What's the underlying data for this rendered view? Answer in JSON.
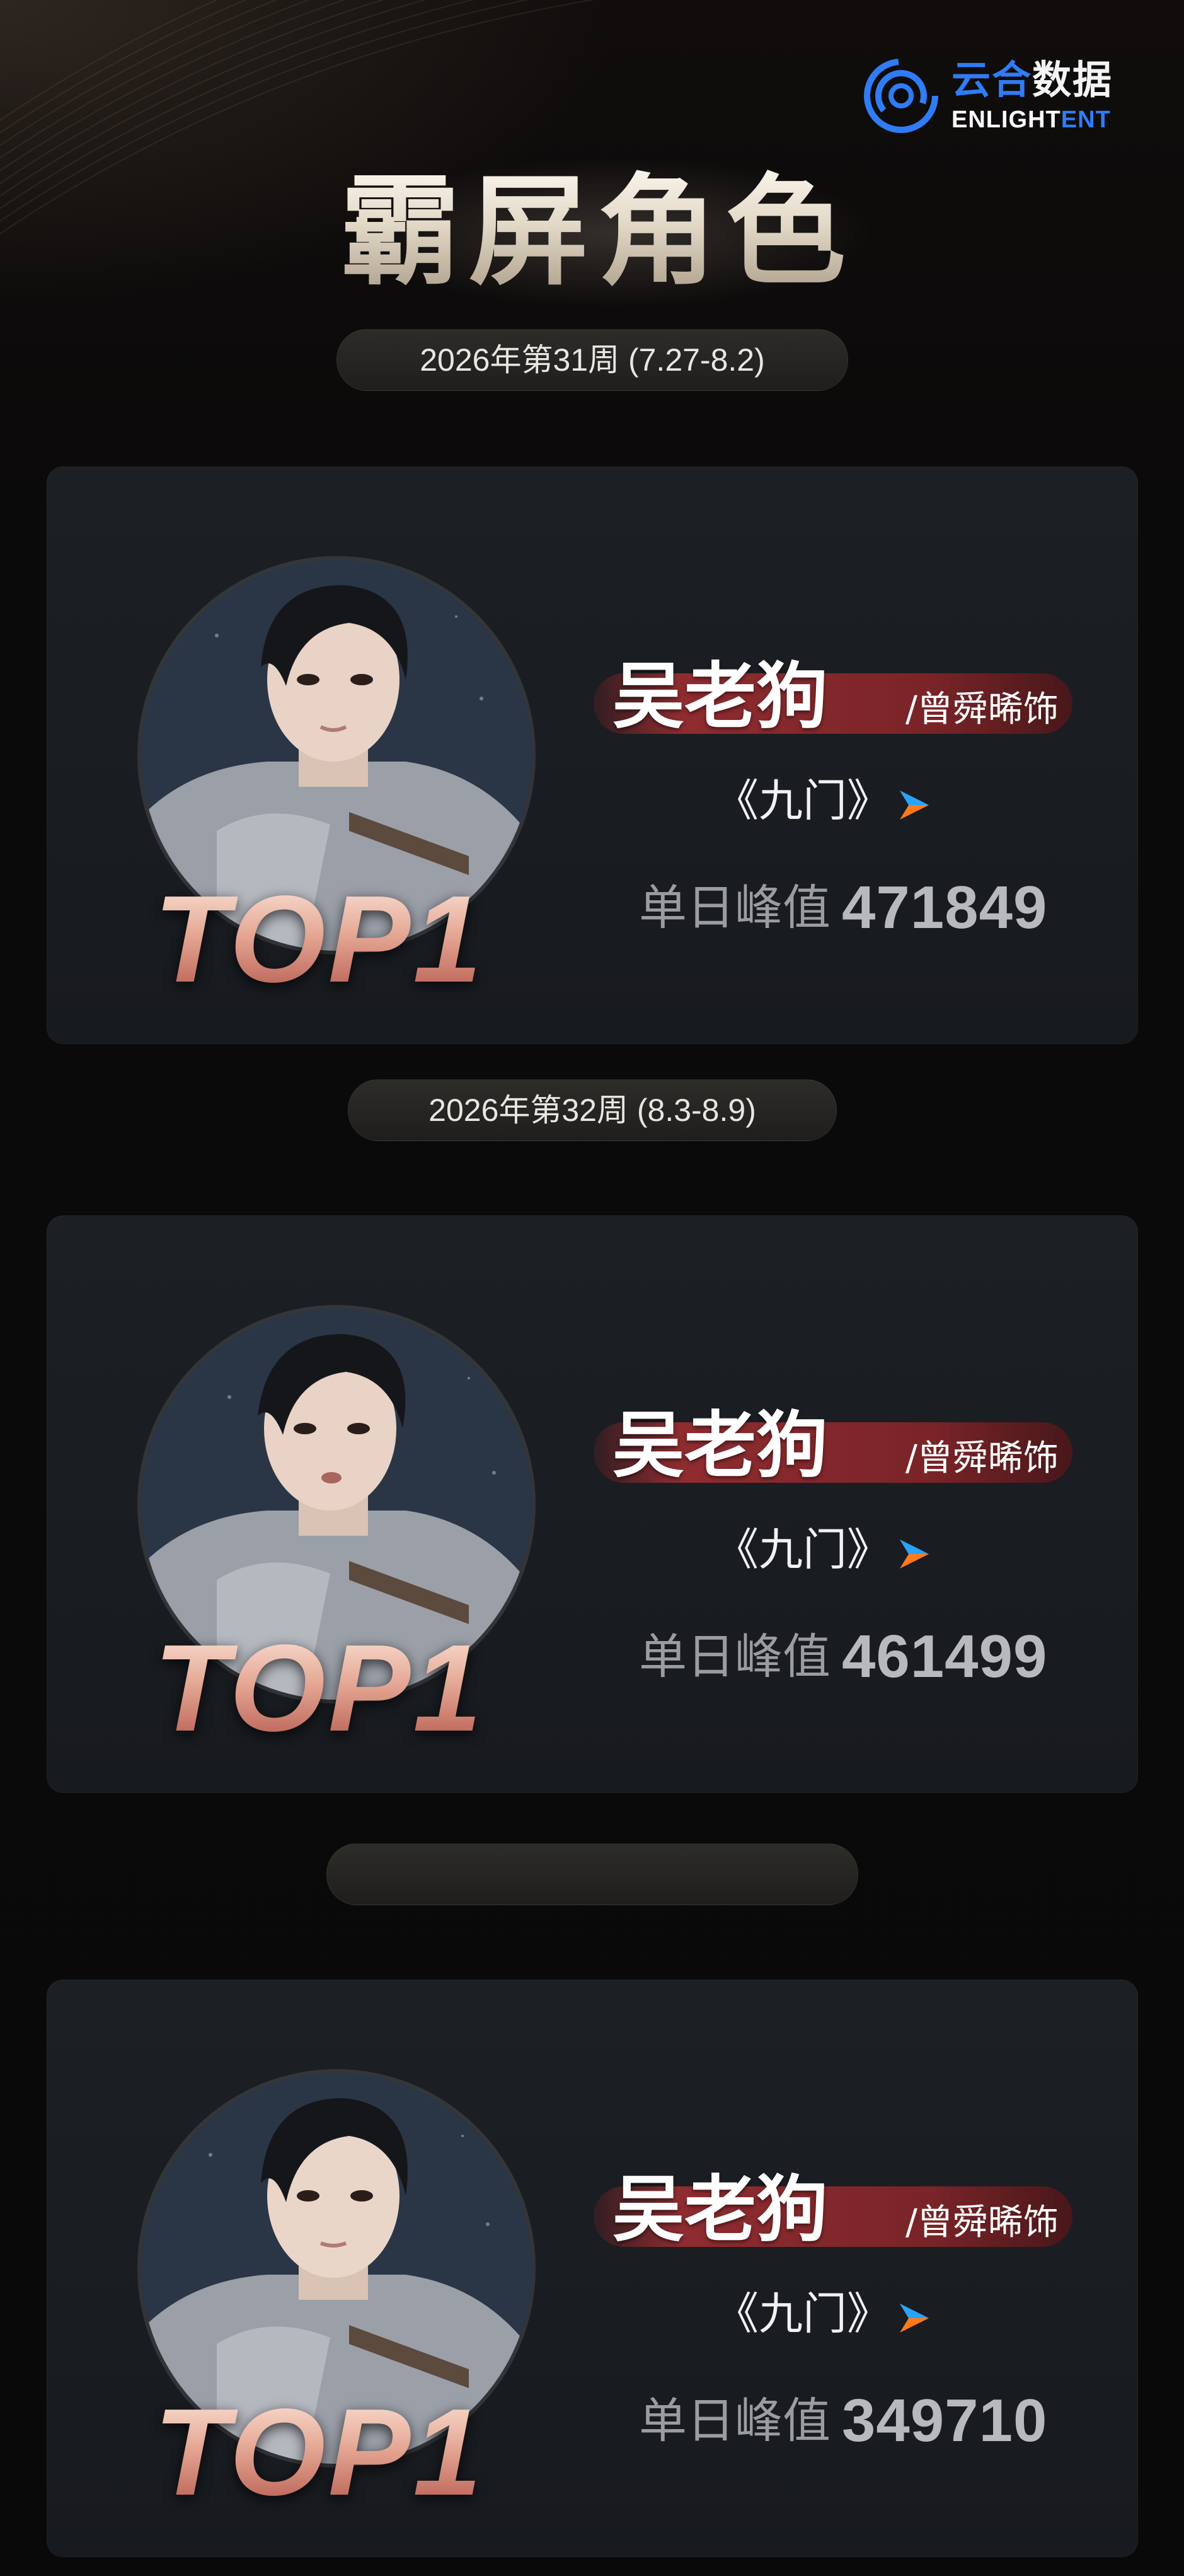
{
  "brand": {
    "name_cn_part1": "云合",
    "name_cn_part2": "数据",
    "name_en_part1": "ENLIGHT",
    "name_en_part2": "ENT",
    "accent_color": "#2f7cf6"
  },
  "title": "霸屏角色",
  "weeks": [
    {
      "label": "2026年第31周 (7.27-8.2)",
      "role": "吴老狗",
      "actor": "/曾舜晞饰",
      "drama": "《九门》",
      "platform_icon": "play-logo-icon",
      "rank": "TOP1",
      "peak_label": "单日峰值",
      "peak_value": "471849"
    },
    {
      "label": "2026年第32周 (8.3-8.9)",
      "role": "吴老狗",
      "actor": "/曾舜晞饰",
      "drama": "《九门》",
      "platform_icon": "play-logo-icon",
      "rank": "TOP1",
      "peak_label": "单日峰值",
      "peak_value": "461499"
    },
    {
      "label": "",
      "role": "吴老狗",
      "actor": "/曾舜晞饰",
      "drama": "《九门》",
      "platform_icon": "play-logo-icon",
      "rank": "TOP1",
      "peak_label": "单日峰值",
      "peak_value": "349710"
    }
  ]
}
